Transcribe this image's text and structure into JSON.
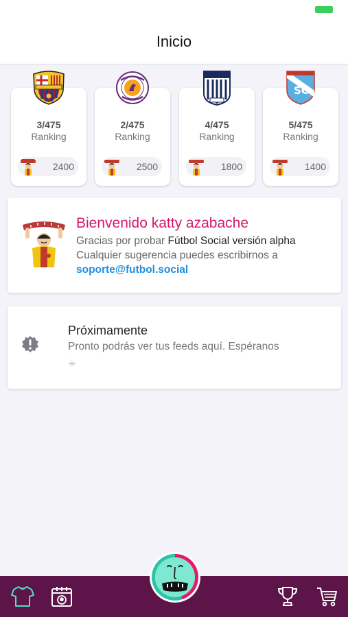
{
  "header": {
    "title": "Inicio"
  },
  "teams": [
    {
      "position": "3/475",
      "label": "Ranking",
      "points": "2400",
      "logo_icon": "fc-barcelona-crest-icon"
    },
    {
      "position": "2/475",
      "label": "Ranking",
      "points": "2500",
      "logo_icon": "inti-gas-crest-icon"
    },
    {
      "position": "4/475",
      "label": "Ranking",
      "points": "1800",
      "logo_icon": "alianza-lima-crest-icon"
    },
    {
      "position": "5/475",
      "label": "Ranking",
      "points": "1400",
      "logo_icon": "sporting-cristal-crest-icon"
    }
  ],
  "welcome": {
    "title": "Bienvenido katty azabache",
    "text_1": "Gracias por probar ",
    "app_name": "Fútbol Social versión alpha",
    "text_2": " Cualquier sugerencia puedes escribirnos a ",
    "email": "soporte@futbol.social"
  },
  "upcoming": {
    "title": "Próximamente",
    "text": "Pronto podrás ver tus feeds aquí. Espéranos",
    "emoji": "☕"
  },
  "bottom_nav": {
    "items": [
      "jersey-icon",
      "calendar-ball-icon",
      "trophy-icon",
      "cart-icon"
    ]
  },
  "colors": {
    "accent": "#d41a6c",
    "link": "#1f8de0",
    "bar": "#5c1449",
    "battery": "#3ccf5b"
  }
}
